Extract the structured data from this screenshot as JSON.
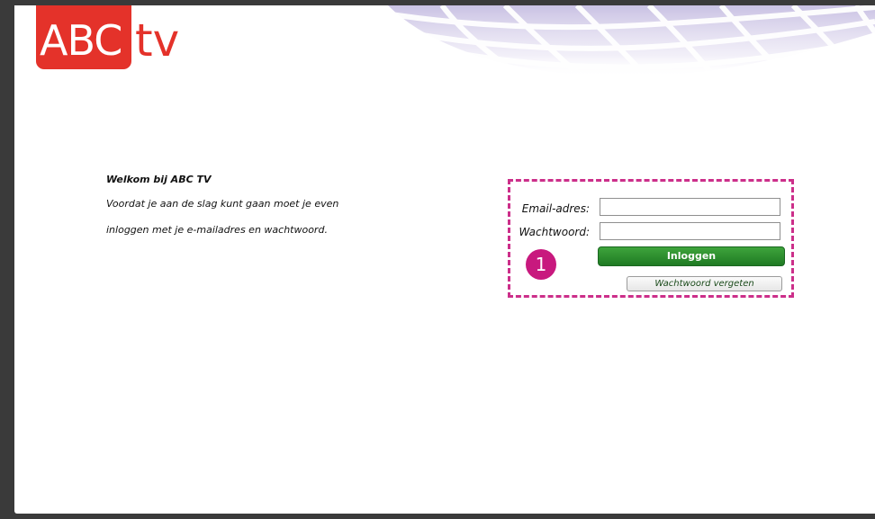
{
  "branding": {
    "logo_text_boxed": "ABC",
    "logo_text_plain": "tv",
    "accent_color": "#e4322a"
  },
  "welcome": {
    "title": "Welkom bij ABC TV",
    "line1": "Voordat je aan de slag kunt gaan moet je even",
    "line2": "inloggen met je e-mailadres en wachtwoord."
  },
  "login_form": {
    "email_label": "Email-adres:",
    "email_value": "",
    "password_label": "Wachtwoord:",
    "password_value": "",
    "login_button": "Inloggen",
    "forgot_button": "Wachtwoord vergeten",
    "button_color": "#2a8a2c"
  },
  "annotation": {
    "step_number": "1",
    "highlight_color": "#cc2f8a"
  }
}
